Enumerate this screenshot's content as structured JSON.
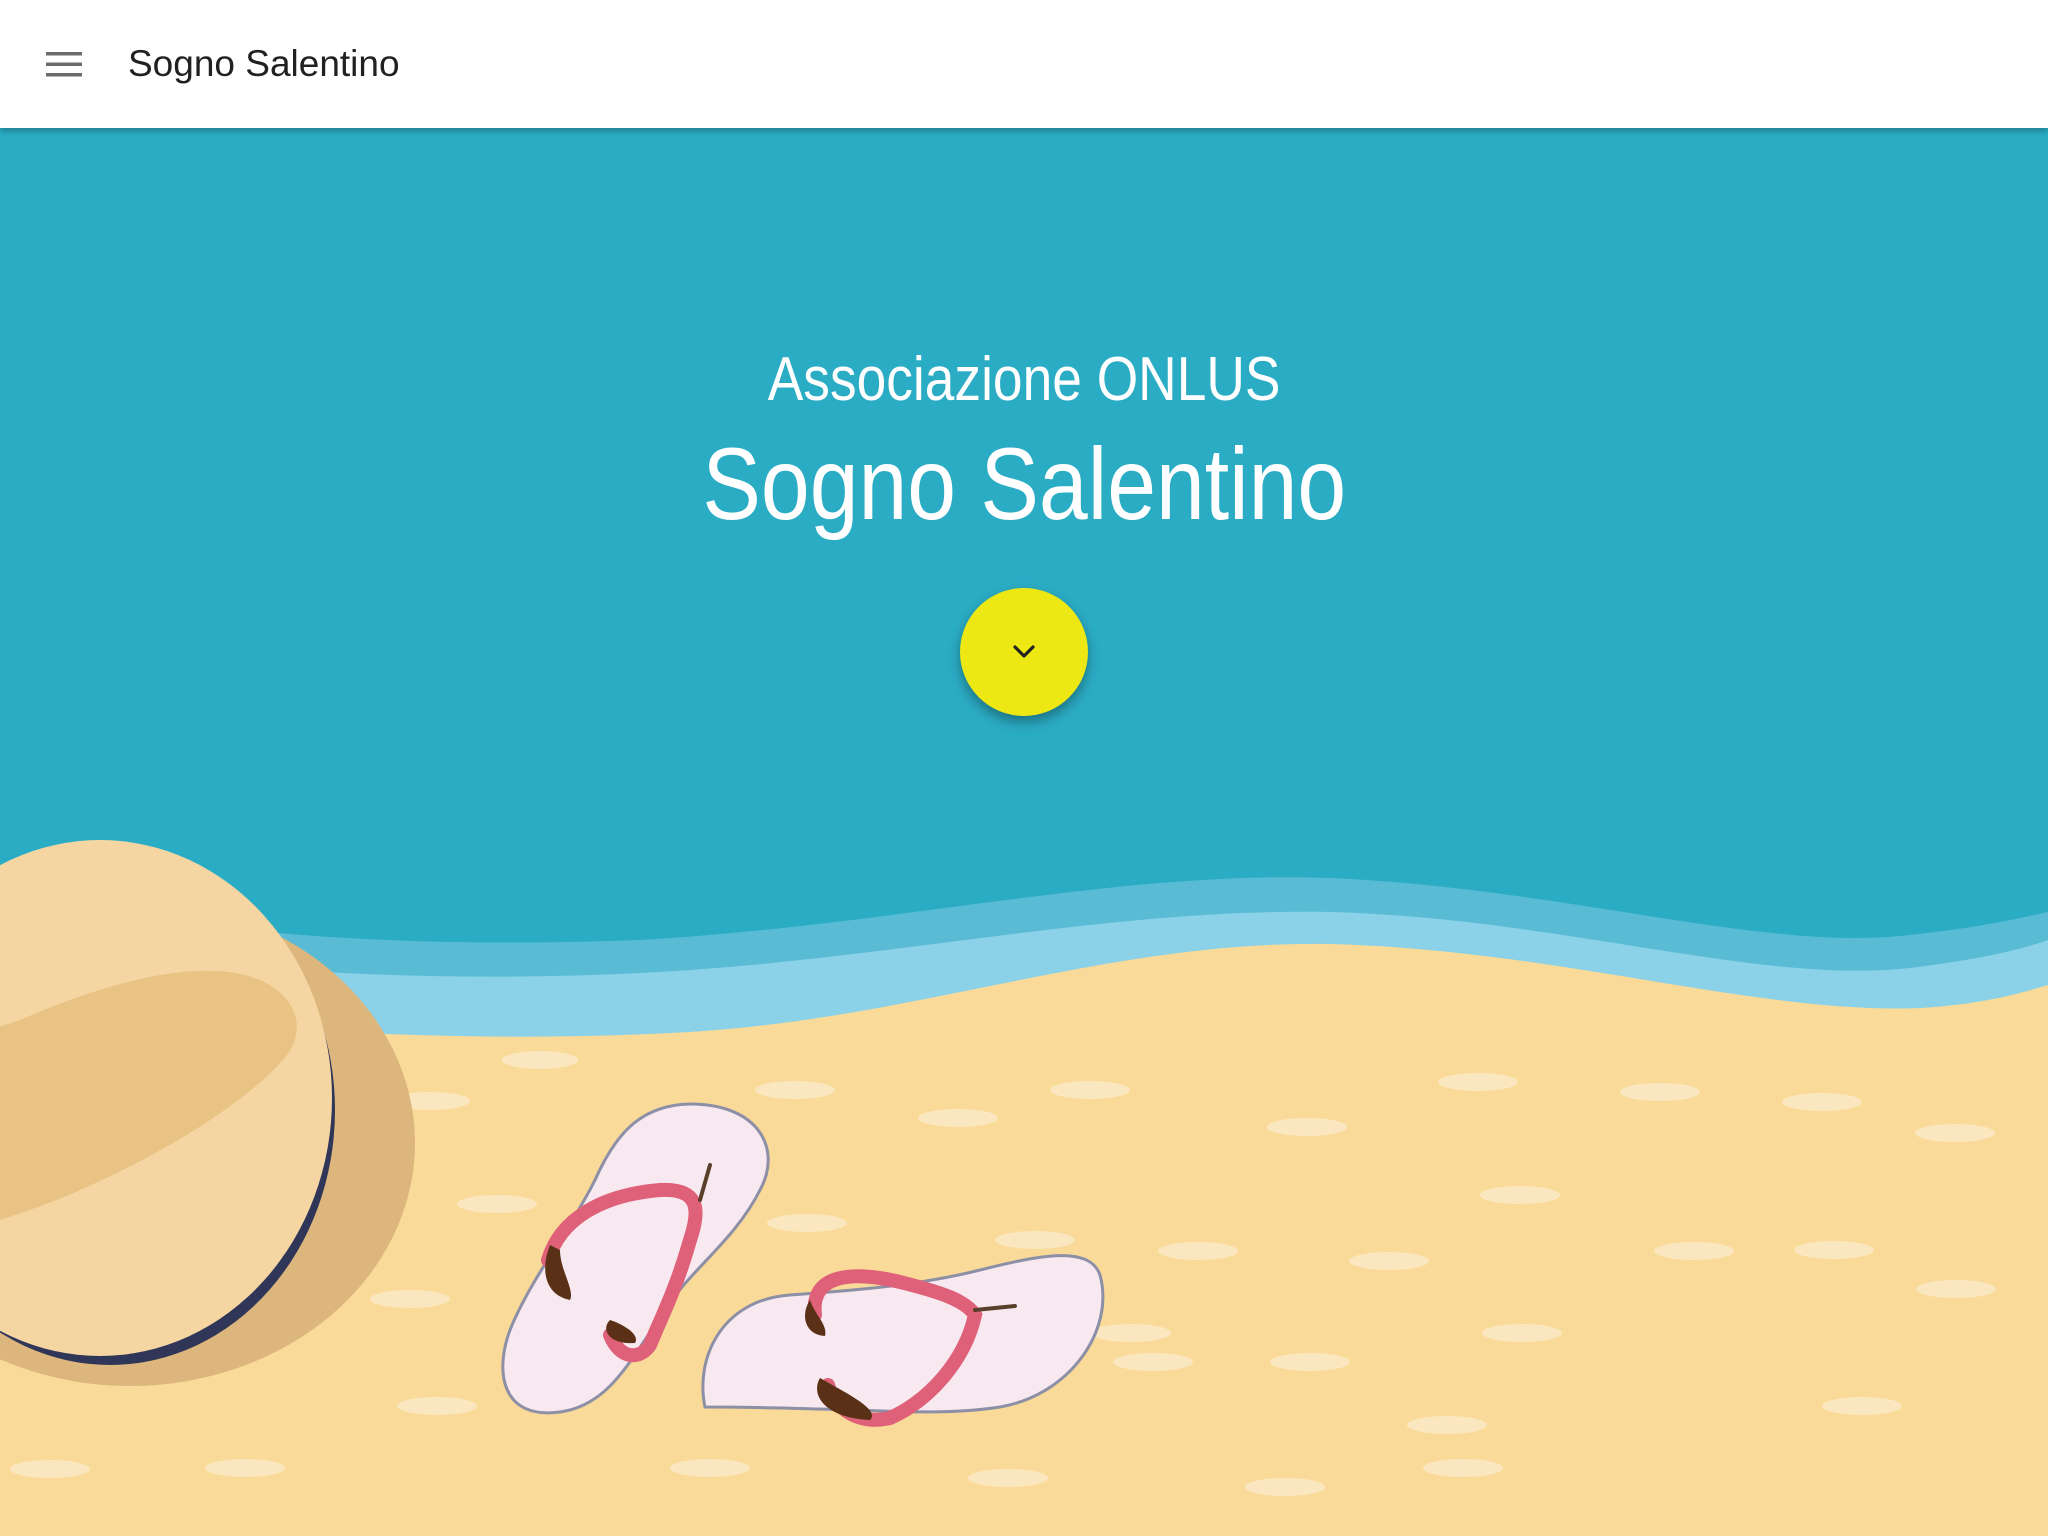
{
  "appbar": {
    "title": "Sogno Salentino",
    "menu_icon": "menu-icon"
  },
  "hero": {
    "subtitle": "Associazione ONLUS",
    "title": "Sogno Salentino",
    "scroll_button_icon": "chevron-down-icon"
  },
  "colors": {
    "sea": "#2bacc5",
    "sand": "#f9da98",
    "fab": "#ede814",
    "appbar": "#ffffff"
  }
}
